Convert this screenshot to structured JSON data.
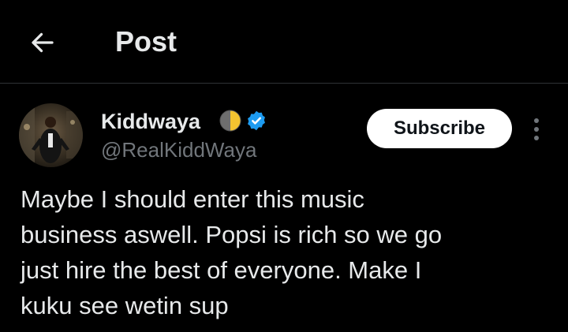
{
  "header": {
    "title": "Post",
    "back_icon": "arrow-left-icon"
  },
  "author": {
    "display_name": "Kiddwaya",
    "handle": "@RealKiddWaya",
    "badges": [
      "moon-half-icon",
      "verified-check-icon"
    ],
    "verified_color": "#1d9bf0"
  },
  "actions": {
    "subscribe_label": "Subscribe",
    "more_icon": "more-vertical-icon"
  },
  "post": {
    "lines": [
      "Maybe I should enter this music",
      "business aswell. Popsi is rich so we go",
      "just hire the best of everyone. Make I",
      "kuku see wetin sup"
    ]
  },
  "colors": {
    "background": "#000000",
    "text_primary": "#e7e9ea",
    "text_secondary": "#71767b",
    "divider": "#2f3336",
    "button_bg": "#ffffff"
  }
}
